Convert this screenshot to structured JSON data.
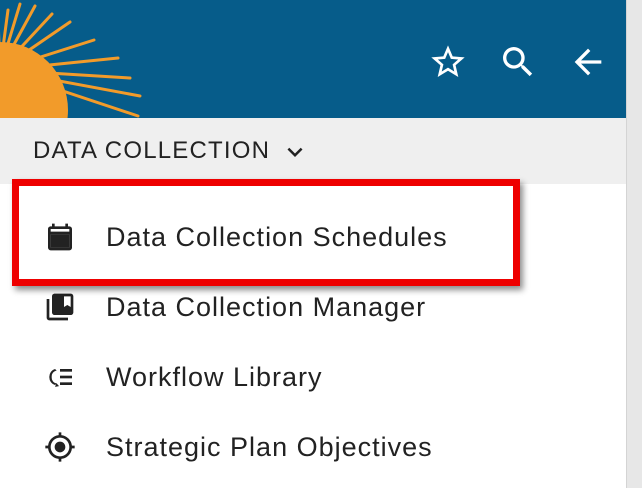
{
  "header": {
    "logo": "sun-logo",
    "brand_colors": {
      "bar": "#065c8a",
      "sun": "#f29b2a"
    },
    "actions": [
      {
        "icon": "star-icon",
        "label": "Favorite"
      },
      {
        "icon": "search-icon",
        "label": "Search"
      },
      {
        "icon": "back-arrow-icon",
        "label": "Back"
      }
    ]
  },
  "section": {
    "title": "DATA COLLECTION",
    "chevron_icon": "chevron-down-icon"
  },
  "menu": {
    "items": [
      {
        "label": "Data Collection Schedules",
        "icon": "calendar-icon"
      },
      {
        "label": "Data Collection Manager",
        "icon": "collections-bookmark-icon"
      },
      {
        "label": "Workflow Library",
        "icon": "workflow-list-icon"
      },
      {
        "label": "Strategic Plan Objectives",
        "icon": "target-icon"
      }
    ]
  },
  "highlight": {
    "color": "#ee0000",
    "target": "Data Collection Schedules"
  }
}
